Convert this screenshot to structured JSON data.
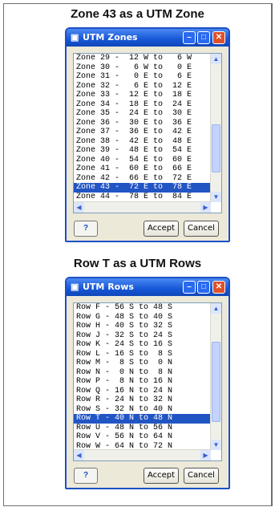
{
  "zone_dialog": {
    "caption": "Zone 43 as a UTM Zone",
    "title": "UTM Zones",
    "rows": [
      "Zone 29 -  12 W to   6 W",
      "Zone 30 -   6 W to   0 E",
      "Zone 31 -   0 E to   6 E",
      "Zone 32 -   6 E to  12 E",
      "Zone 33 -  12 E to  18 E",
      "Zone 34 -  18 E to  24 E",
      "Zone 35 -  24 E to  30 E",
      "Zone 36 -  30 E to  36 E",
      "Zone 37 -  36 E to  42 E",
      "Zone 38 -  42 E to  48 E",
      "Zone 39 -  48 E to  54 E",
      "Zone 40 -  54 E to  60 E",
      "Zone 41 -  60 E to  66 E",
      "Zone 42 -  66 E to  72 E",
      "Zone 43 -  72 E to  78 E",
      "Zone 44 -  78 E to  84 E"
    ],
    "selected_index": 14,
    "help_label": "?",
    "accept_label": "Accept",
    "cancel_label": "Cancel"
  },
  "row_dialog": {
    "caption": "Row T as a UTM Rows",
    "title": "UTM Rows",
    "rows": [
      "Row F - 56 S to 48 S",
      "Row G - 48 S to 40 S",
      "Row H - 40 S to 32 S",
      "Row J - 32 S to 24 S",
      "Row K - 24 S to 16 S",
      "Row L - 16 S to  8 S",
      "Row M -  8 S to  0 N",
      "Row N -  0 N to  8 N",
      "Row P -  8 N to 16 N",
      "Row Q - 16 N to 24 N",
      "Row R - 24 N to 32 N",
      "Row S - 32 N to 40 N",
      "Row T - 40 N to 48 N",
      "Row U - 48 N to 56 N",
      "Row V - 56 N to 64 N",
      "Row W - 64 N to 72 N"
    ],
    "selected_index": 12,
    "help_label": "?",
    "accept_label": "Accept",
    "cancel_label": "Cancel"
  },
  "colors": {
    "title_bar": "#1656d6",
    "selection": "#2255c4",
    "close_button": "#e0502a"
  },
  "icons": [
    "app-icon",
    "minimize-icon",
    "maximize-icon",
    "close-icon",
    "help-icon",
    "scroll-up-icon",
    "scroll-down-icon",
    "scroll-left-icon",
    "scroll-right-icon"
  ]
}
